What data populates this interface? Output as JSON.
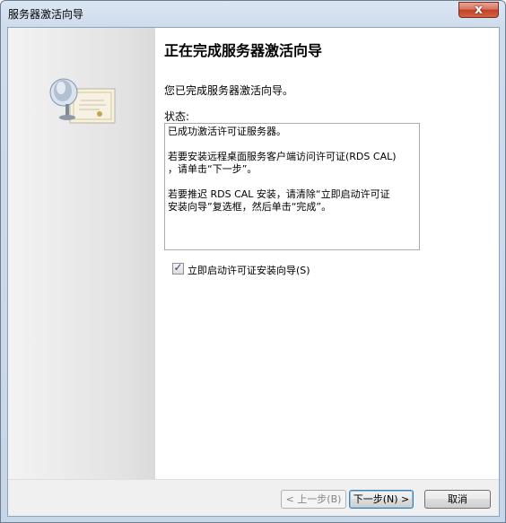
{
  "window": {
    "title": "服务器激活向导",
    "close_label": "x"
  },
  "header": {
    "title": "正在完成服务器激活向导"
  },
  "main": {
    "intro": "您已完成服务器激活向导。",
    "status_label": "状态:",
    "status_lines": [
      "已成功激活许可证服务器。",
      "若要安装远程桌面服务客户端访问许可证(RDS CAL)\n，请单击“下一步”。",
      "若要推迟 RDS CAL 安装，请清除“立即启动许可证\n安装向导”复选框，然后单击“完成”。"
    ],
    "checkbox": {
      "label": "立即启动许可证安装向导(S)",
      "checked": true
    }
  },
  "footer": {
    "back_label": "< 上一步(B)",
    "next_label": "下一步(N) >",
    "cancel_label": "取消"
  },
  "icon": "server-certificate-icon"
}
